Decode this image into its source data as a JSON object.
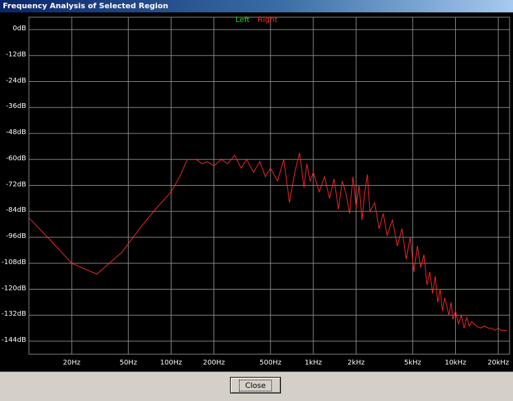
{
  "window": {
    "title": "Frequency Analysis of Selected Region"
  },
  "legend": {
    "left": "Left",
    "right": "Right"
  },
  "buttons": {
    "close": "Close"
  },
  "colors": {
    "left": "#19d919",
    "right": "#ff2a2a",
    "grid": "#8c8c8c",
    "background": "#000000"
  },
  "chart_data": {
    "type": "line",
    "title": "",
    "xlabel": "",
    "ylabel": "",
    "x_scale": "log",
    "xlim": [
      10,
      24000
    ],
    "ylim": [
      -150,
      0
    ],
    "grid": true,
    "legend_placement": "top-center",
    "y_ticks": [
      {
        "value": 0,
        "label": "0dB"
      },
      {
        "value": -12,
        "label": "-12dB"
      },
      {
        "value": -24,
        "label": "-24dB"
      },
      {
        "value": -36,
        "label": "-36dB"
      },
      {
        "value": -48,
        "label": "-48dB"
      },
      {
        "value": -60,
        "label": "-60dB"
      },
      {
        "value": -72,
        "label": "-72dB"
      },
      {
        "value": -84,
        "label": "-84dB"
      },
      {
        "value": -96,
        "label": "-96dB"
      },
      {
        "value": -108,
        "label": "-108dB"
      },
      {
        "value": -120,
        "label": "-120dB"
      },
      {
        "value": -132,
        "label": "-132dB"
      },
      {
        "value": -144,
        "label": "-144dB"
      }
    ],
    "x_ticks": [
      {
        "value": 20,
        "label": "20Hz"
      },
      {
        "value": 50,
        "label": "50Hz"
      },
      {
        "value": 100,
        "label": "100Hz"
      },
      {
        "value": 200,
        "label": "200Hz"
      },
      {
        "value": 500,
        "label": "500Hz"
      },
      {
        "value": 1000,
        "label": "1kHz"
      },
      {
        "value": 2000,
        "label": "2kHz"
      },
      {
        "value": 5000,
        "label": "5kHz"
      },
      {
        "value": 10000,
        "label": "10kHz"
      },
      {
        "value": 20000,
        "label": "20kHz"
      }
    ],
    "series": [
      {
        "name": "Left",
        "values": []
      },
      {
        "name": "Right",
        "x": [
          10,
          14,
          20,
          30,
          45,
          60,
          80,
          100,
          115,
          130,
          150,
          165,
          180,
          200,
          225,
          250,
          280,
          310,
          340,
          380,
          420,
          460,
          500,
          560,
          620,
          680,
          740,
          800,
          860,
          900,
          950,
          1000,
          1100,
          1200,
          1300,
          1400,
          1500,
          1600,
          1700,
          1800,
          1900,
          2000,
          2100,
          2200,
          2300,
          2400,
          2500,
          2700,
          2900,
          3100,
          3300,
          3600,
          3900,
          4200,
          4500,
          4800,
          5100,
          5400,
          5700,
          6000,
          6300,
          6600,
          6900,
          7200,
          7500,
          7800,
          8100,
          8400,
          8700,
          9000,
          9300,
          9600,
          10000,
          10500,
          11000,
          11500,
          12000,
          12500,
          13000,
          14000,
          15000,
          16000,
          17000,
          18000,
          19000,
          20000,
          21000,
          22000,
          23000
        ],
        "values": [
          -87,
          -97,
          -108,
          -113,
          -103,
          -92,
          -82,
          -75,
          -68,
          -60,
          -60,
          -62,
          -61,
          -63,
          -60,
          -62,
          -58,
          -64,
          -60,
          -66,
          -61,
          -68,
          -64,
          -70,
          -60,
          -80,
          -66,
          -57,
          -73,
          -62,
          -70,
          -66,
          -75,
          -68,
          -78,
          -69,
          -83,
          -70,
          -76,
          -85,
          -68,
          -82,
          -72,
          -88,
          -75,
          -67,
          -84,
          -80,
          -92,
          -85,
          -95,
          -88,
          -100,
          -92,
          -106,
          -96,
          -112,
          -100,
          -110,
          -104,
          -118,
          -112,
          -122,
          -114,
          -126,
          -120,
          -130,
          -124,
          -128,
          -132,
          -126,
          -134,
          -130,
          -136,
          -132,
          -138,
          -133,
          -137,
          -135,
          -137,
          -138,
          -137,
          -138,
          -138,
          -139,
          -138,
          -139,
          -139,
          -139
        ]
      }
    ]
  }
}
